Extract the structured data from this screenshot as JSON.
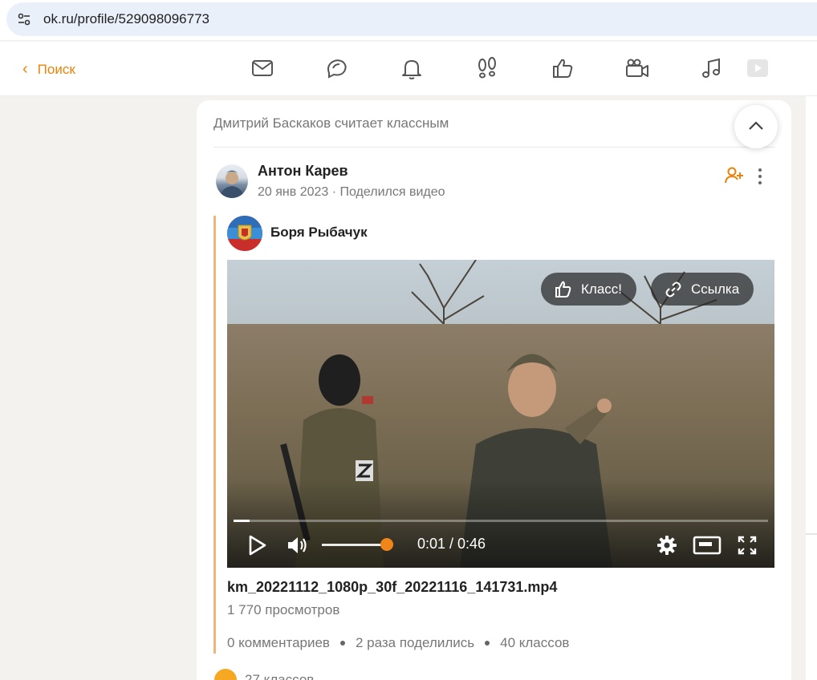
{
  "browser": {
    "url": "ok.ru/profile/529098096773"
  },
  "nav": {
    "back_label": "Поиск",
    "icons": [
      "messages-icon",
      "discussions-icon",
      "notifications-icon",
      "guests-icon",
      "events-icon",
      "video-calls-icon",
      "music-icon",
      "video-icon"
    ]
  },
  "feed": {
    "liked_by": "Дмитрий Баскаков считает классным",
    "post": {
      "author": "Антон Карев",
      "date": "20 янв 2023",
      "meta_sep": " · ",
      "action": "Поделился видео",
      "shared_from": "Боря Рыбачук",
      "video": {
        "klass_label": "Класс!",
        "link_label": "Ссылка",
        "time": "0:01 / 0:46",
        "progress": 0.03,
        "volume": 1.0
      },
      "file_name": "km_20221112_1080p_30f_20221116_141731.mp4",
      "views": "1 770 просмотров",
      "stats": [
        "0 комментариев",
        "2 раза поделились",
        "40 классов"
      ],
      "klass_count": "27 классов"
    }
  },
  "colors": {
    "accent": "#ee8208",
    "progress_knob": "#f08519"
  }
}
